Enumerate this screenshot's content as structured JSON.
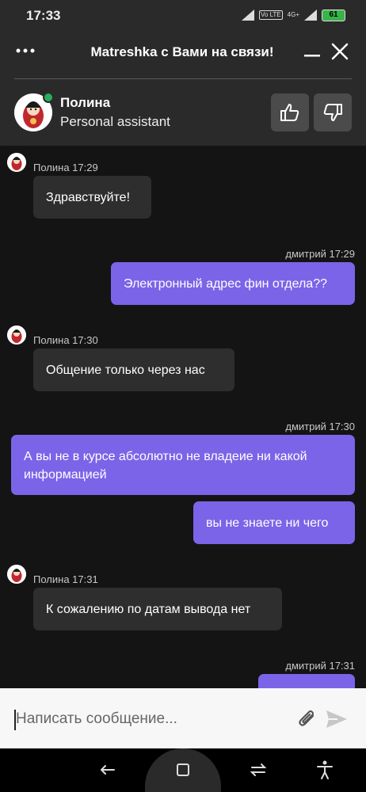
{
  "status_bar": {
    "time": "17:33",
    "volte_label": "Vo LTE",
    "network_label": "4G+",
    "battery_level": "61",
    "icons": [
      "signal-icon",
      "wifi-icon",
      "volte-icon",
      "signal-icon",
      "battery-icon"
    ]
  },
  "header": {
    "title": "Matreshka с Вами на связи!",
    "menu_icon": "more-dots-icon",
    "minimize_icon": "minimize-icon",
    "close_icon": "close-icon"
  },
  "agent": {
    "name": "Полина",
    "role": "Personal assistant",
    "status": "online",
    "status_color": "#27ae60",
    "like_icon": "thumbs-up-icon",
    "dislike_icon": "thumbs-down-icon"
  },
  "messages": [
    {
      "sender": "agent",
      "meta": "Полина 17:29",
      "texts": [
        "Здравствуйте!"
      ]
    },
    {
      "sender": "user",
      "meta": "дмитрий 17:29",
      "texts": [
        "Электронный адрес фин отдела??"
      ]
    },
    {
      "sender": "agent",
      "meta": "Полина 17:30",
      "texts": [
        "Общение только через нас"
      ]
    },
    {
      "sender": "user",
      "meta": "дмитрий 17:30",
      "texts": [
        "А вы не в курсе абсолютно не владеие ни какой информацией",
        "вы не знаете ни чего"
      ]
    },
    {
      "sender": "agent",
      "meta": "Полина 17:31",
      "texts": [
        "К сожалению по датам вывода нет"
      ]
    },
    {
      "sender": "user",
      "meta": "дмитрий 17:31",
      "texts": [
        ""
      ]
    }
  ],
  "composer": {
    "placeholder": "Написать сообщение...",
    "value": "",
    "attach_icon": "paperclip-icon",
    "send_icon": "send-icon"
  },
  "nav_bar": {
    "icons": [
      "back-icon",
      "home-icon",
      "recents-icon",
      "accessibility-icon"
    ]
  },
  "colors": {
    "background": "#141414",
    "header": "#2a2a2a",
    "agent_bubble": "#2e2e2e",
    "user_bubble": "#7b64e8",
    "composer": "#f7f7f7"
  }
}
